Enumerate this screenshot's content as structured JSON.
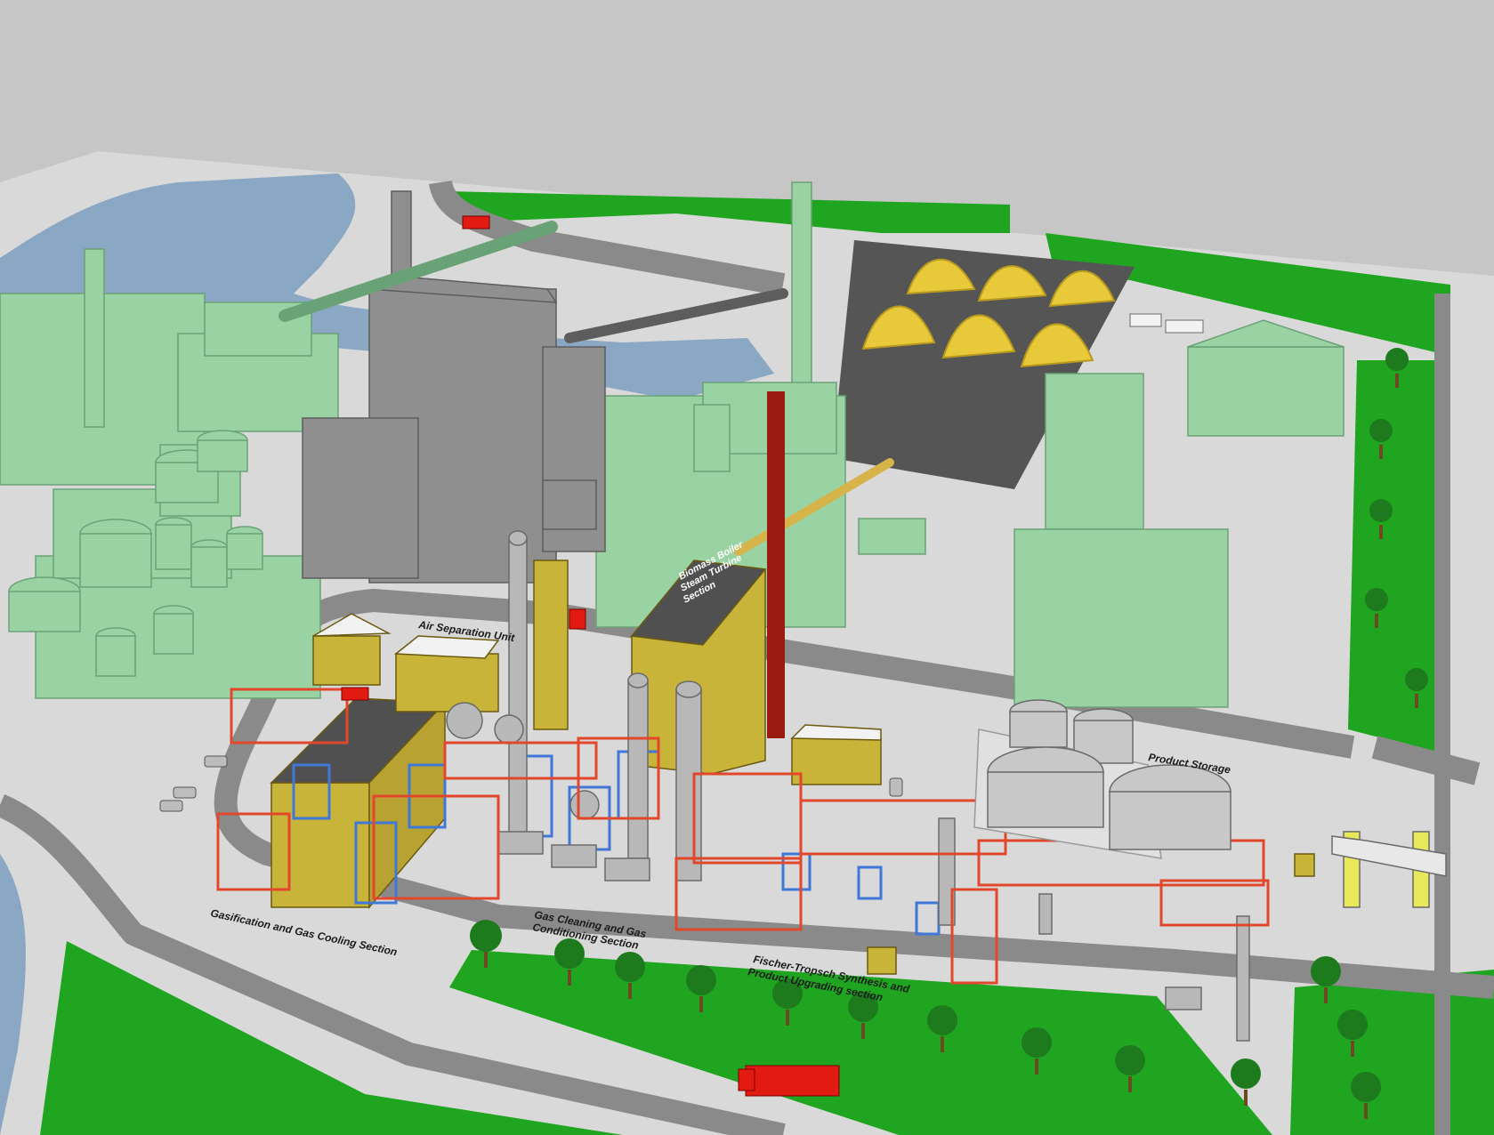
{
  "labels": {
    "air_separation": "Air Separation Unit",
    "biomass_boiler_line1": "Biomass Boiler",
    "biomass_boiler_line2": "Steam Turbine",
    "biomass_boiler_line3": "Section",
    "product_storage": "Product Storage",
    "gasification": "Gasification and Gas Cooling Section",
    "gas_cleaning_line1": "Gas Cleaning and Gas",
    "gas_cleaning_line2": "Conditioning Section",
    "ft_line1": "Fischer-Tropsch Synthesis and",
    "ft_line2": "Product Upgrading section"
  },
  "colors": {
    "sky": "#c6c6c6",
    "ground": "#d9d9d9",
    "road": "#8a8a8a",
    "grass": "#1fa51f",
    "water": "#8aa7c4",
    "existing_plant": "#99d3a3",
    "new_plant": "#c9b43a",
    "pipe_rack": "#e2472c",
    "column": "#b8b8b8",
    "structure_blue": "#3f78d6",
    "biomass_pile": "#e7c93a",
    "stack_red": "#9b1b12",
    "truck": "#e11a12"
  },
  "icons": [
    "truck-icon",
    "tree-icon",
    "car-icon"
  ]
}
